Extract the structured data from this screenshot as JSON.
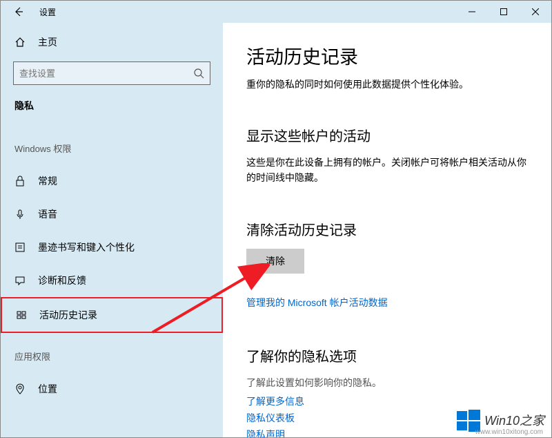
{
  "titlebar": {
    "app_title": "设置"
  },
  "sidebar": {
    "home_label": "主页",
    "search_placeholder": "查找设置",
    "category_label": "隐私",
    "section1_label": "Windows 权限",
    "section2_label": "应用权限",
    "items": [
      {
        "label": "常规"
      },
      {
        "label": "语音"
      },
      {
        "label": "墨迹书写和键入个性化"
      },
      {
        "label": "诊断和反馈"
      },
      {
        "label": "活动历史记录"
      },
      {
        "label": "位置"
      }
    ]
  },
  "main": {
    "heading": "活动历史记录",
    "cut_text": "重你的隐私的同时如何使用此数据提供个性化体验。",
    "section1": {
      "title": "显示这些帐户的活动",
      "desc": "这些是你在此设备上拥有的帐户。关闭帐户可将帐户相关活动从你的时间线中隐藏。"
    },
    "section2": {
      "title": "清除活动历史记录",
      "button_label": "清除",
      "link": "管理我的 Microsoft 帐户活动数据"
    },
    "section3": {
      "title": "了解你的隐私选项",
      "desc": "了解此设置如何影响你的隐私。",
      "links": [
        "了解更多信息",
        "隐私仪表板",
        "隐私声明"
      ]
    }
  },
  "watermark": {
    "brand": "Win10之家",
    "url": "www.win10xitong.com"
  }
}
